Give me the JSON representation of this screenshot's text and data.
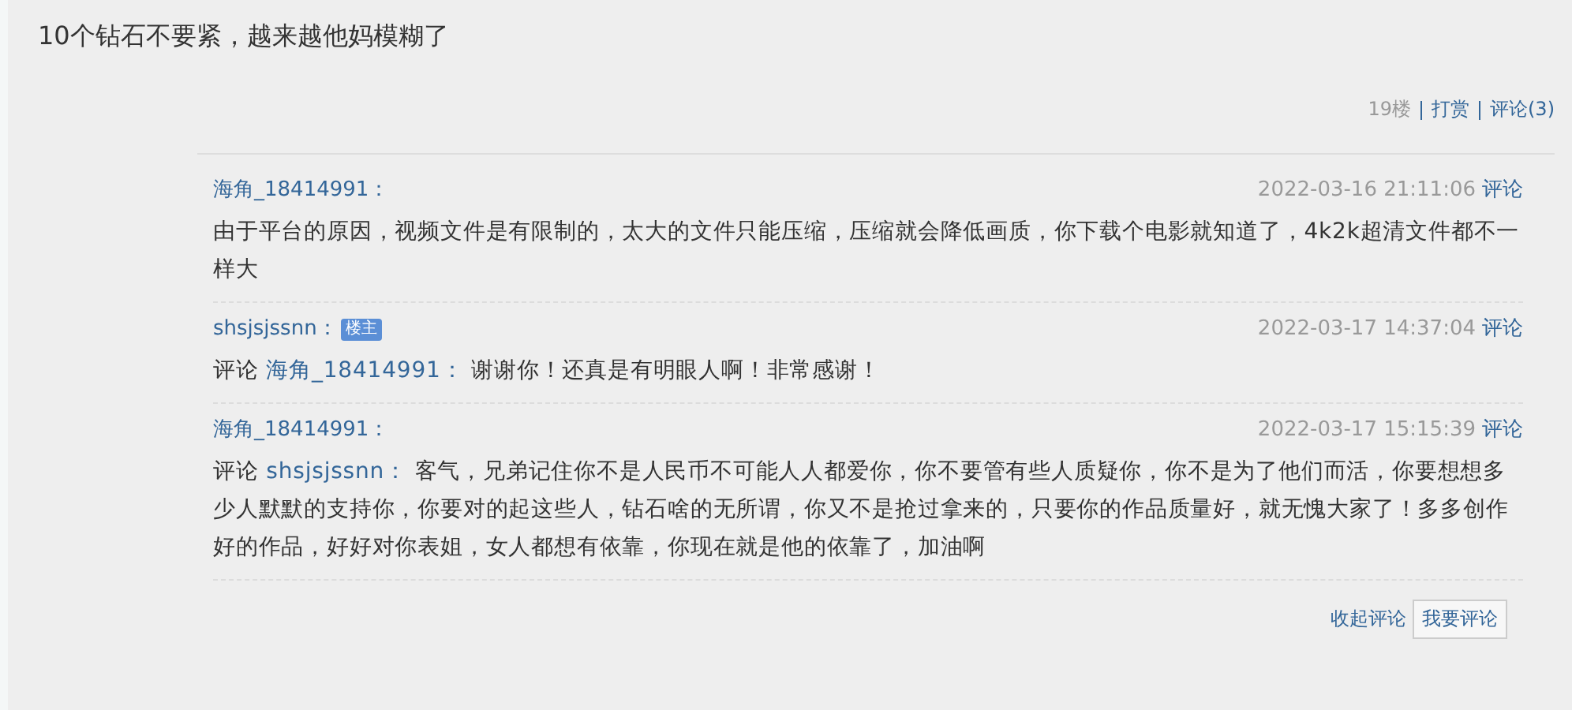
{
  "post": {
    "text": "10个钻石不要紧，越来越他妈模糊了",
    "floor": "19楼",
    "reward_link": "打赏",
    "comments_link": "评论(3)"
  },
  "replies": [
    {
      "author": "海角_18414991：",
      "time": "2022-03-16 21:11:06",
      "reply_link": "评论",
      "text": "由于平台的原因，视频文件是有限制的，太大的文件只能压缩，压缩就会降低画质，你下载个电影就知道了，4k2k超清文件都不一样大"
    },
    {
      "author": "shsjsjssnn：",
      "badge": "楼主",
      "time": "2022-03-17 14:37:04",
      "reply_link": "评论",
      "prefix": "评论",
      "target": "海角_18414991：",
      "text": "谢谢你！还真是有明眼人啊！非常感谢！"
    },
    {
      "author": "海角_18414991：",
      "time": "2022-03-17 15:15:39",
      "reply_link": "评论",
      "prefix": "评论",
      "target": "shsjsjssnn：",
      "text": "客气，兄弟记住你不是人民币不可能人人都爱你，你不要管有些人质疑你，你不是为了他们而活，你要想想多少人默默的支持你，你要对的起这些人，钻石啥的无所谓，你又不是抢过拿来的，只要你的作品质量好，就无愧大家了！多多创作好的作品，好好对你表姐，女人都想有依靠，你现在就是他的依靠了，加油啊"
    }
  ],
  "actions": {
    "collapse_link": "收起评论",
    "write_button": "我要评论"
  }
}
